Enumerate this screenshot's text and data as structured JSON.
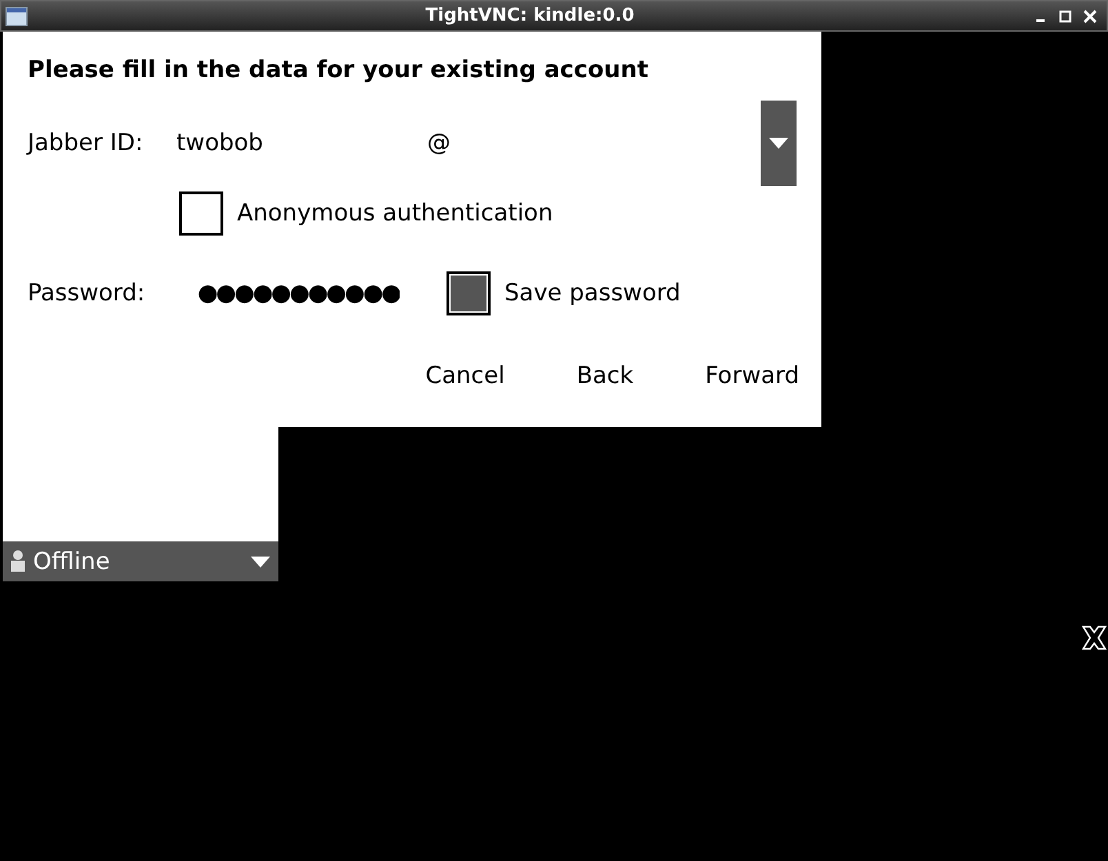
{
  "window": {
    "title": "TightVNC: kindle:0.0"
  },
  "dialog": {
    "heading": "Please fill in the data for your existing account",
    "jabber_label": "Jabber ID:",
    "username": "twobob",
    "at": "@",
    "anonymous": {
      "label": "Anonymous authentication",
      "checked": false
    },
    "password_label": "Password:",
    "password": "●●●●●●●●●●●",
    "save_password": {
      "label": "Save password",
      "checked": true
    },
    "buttons": [
      {
        "label": "Cancel"
      },
      {
        "label": "Back"
      },
      {
        "label": "Forward"
      }
    ]
  },
  "status": {
    "label": "Offline"
  }
}
